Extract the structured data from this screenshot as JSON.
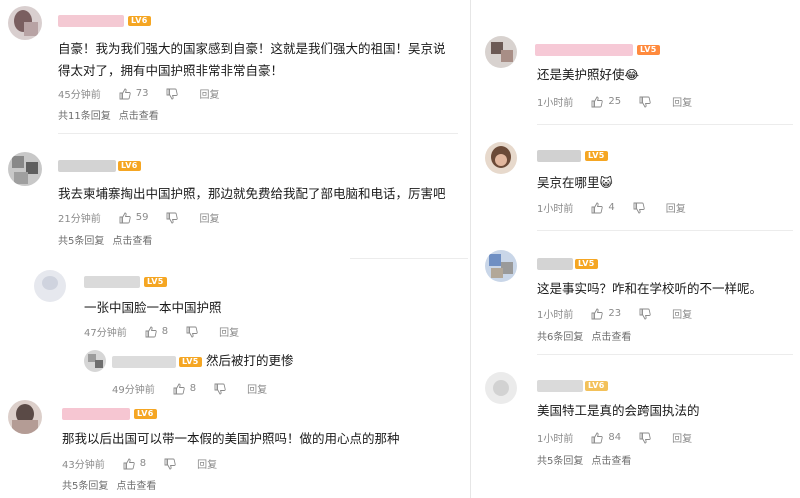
{
  "colors": {
    "lv_badge": "#f5a623",
    "meta": "#8a8a8a",
    "text": "#1a1a1a"
  },
  "left": {
    "comments": [
      {
        "lv": "LV6",
        "text": "自豪！我为我们强大的国家感到自豪！这就是我们强大的祖国！吴京说得太对了，拥有中国护照非常非常自豪！",
        "time": "45分钟前",
        "likes": "73",
        "reply": "回复",
        "more_count": "共11条回复",
        "more_action": "点击查看"
      },
      {
        "lv": "LV6",
        "text": "我去柬埔寨掏出中国护照，那边就免费给我配了部电脑和电话，厉害吧",
        "time": "21分钟前",
        "likes": "59",
        "reply": "回复",
        "more_count": "共5条回复",
        "more_action": "点击查看"
      },
      {
        "lv": "LV5",
        "text": "一张中国脸一本中国护照",
        "time": "47分钟前",
        "likes": "8",
        "reply": "回复"
      },
      {
        "lv": "LV5",
        "text": "然后被打的更惨",
        "time": "49分钟前",
        "likes": "8",
        "reply": "回复"
      },
      {
        "lv": "LV6",
        "text": "那我以后出国可以带一本假的美国护照吗！做的用心点的那种",
        "time": "43分钟前",
        "likes": "8",
        "reply": "回复",
        "more_count": "共5条回复",
        "more_action": "点击查看"
      }
    ]
  },
  "right": {
    "comments": [
      {
        "lv": "LV5",
        "text": "还是美护照好使😂",
        "time": "1小时前",
        "likes": "25",
        "reply": "回复"
      },
      {
        "lv": "LV5",
        "text": "吴京在哪里😺",
        "time": "1小时前",
        "likes": "4",
        "reply": "回复"
      },
      {
        "lv": "LV5",
        "text": "这是事实吗？咋和在学校听的不一样呢。",
        "time": "1小时前",
        "likes": "23",
        "reply": "回复",
        "more_count": "共6条回复",
        "more_action": "点击查看"
      },
      {
        "lv": "LV6",
        "text": "美国特工是真的会跨国执法的",
        "time": "1小时前",
        "likes": "84",
        "reply": "回复",
        "more_count": "共5条回复",
        "more_action": "点击查看"
      }
    ]
  }
}
